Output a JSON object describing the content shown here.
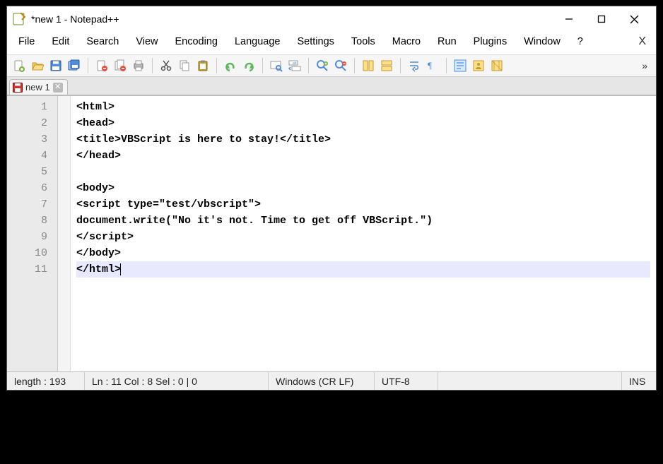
{
  "title": "*new 1 - Notepad++",
  "menu": [
    "File",
    "Edit",
    "Search",
    "View",
    "Encoding",
    "Language",
    "Settings",
    "Tools",
    "Macro",
    "Run",
    "Plugins",
    "Window",
    "?"
  ],
  "toolbar_icons": [
    "new-file-icon",
    "open-file-icon",
    "save-icon",
    "save-all-icon",
    "|",
    "close-file-icon",
    "close-all-icon",
    "print-icon",
    "|",
    "cut-icon",
    "copy-icon",
    "paste-icon",
    "|",
    "undo-icon",
    "redo-icon",
    "|",
    "find-icon",
    "replace-icon",
    "|",
    "zoom-in-icon",
    "zoom-out-icon",
    "|",
    "sync-v-icon",
    "sync-h-icon",
    "|",
    "wrap-icon",
    "show-ws-icon",
    "|",
    "indent-guide-icon",
    "udl-icon",
    "doc-map-icon"
  ],
  "tab": {
    "label": "new 1",
    "dirty": true
  },
  "code_lines": [
    "<html>",
    "<head>",
    "<title>VBScript is here to stay!</title>",
    "</head>",
    "",
    "<body>",
    "<script type=\"test/vbscript\">",
    "document.write(\"No it's not. Time to get off VBScript.\")",
    "</script>",
    "</body>",
    "</html>"
  ],
  "current_line_index": 10,
  "status": {
    "length": "length : 193",
    "pos": "Ln : 11    Col : 8    Sel : 0 | 0",
    "eol": "Windows (CR LF)",
    "encoding": "UTF-8",
    "mode": "INS"
  }
}
